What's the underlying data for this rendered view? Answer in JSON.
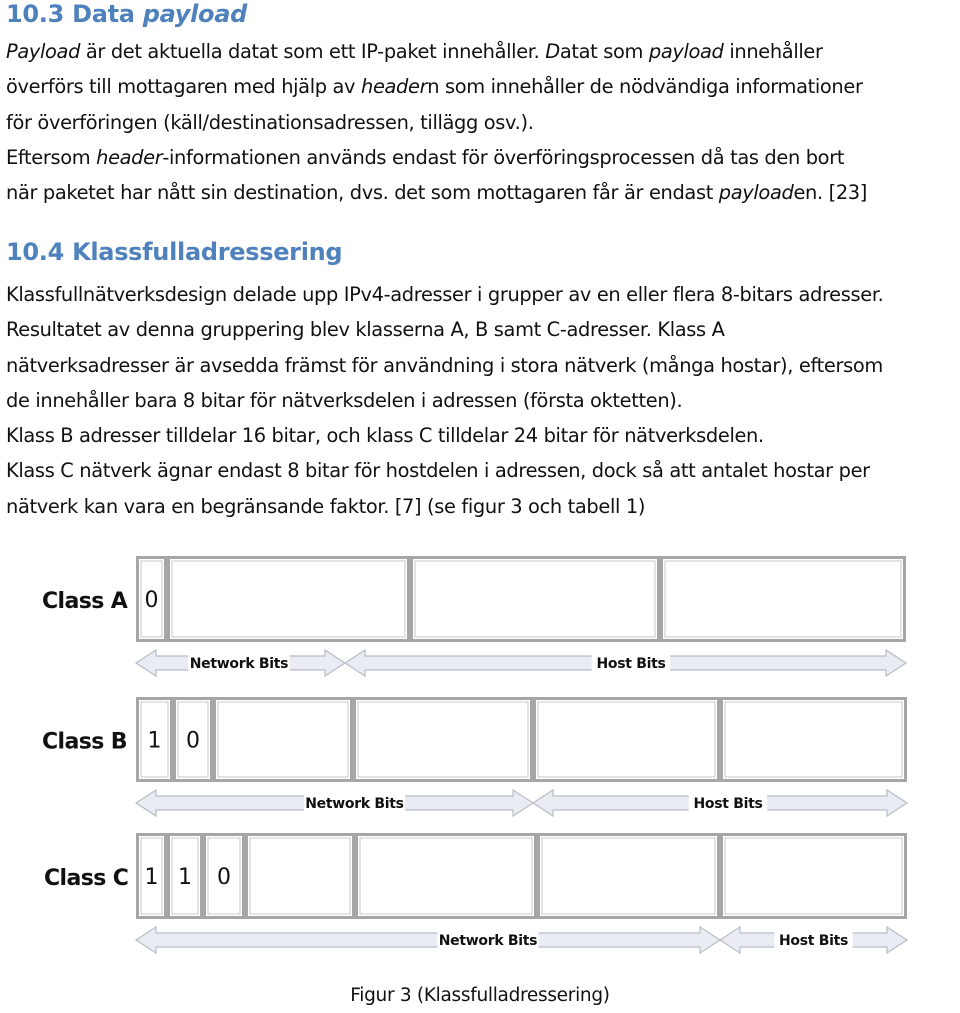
{
  "section_10_3": {
    "number": "10.3",
    "title_plain": "Data",
    "title_italic": "payload",
    "lines": [
      [
        {
          "t": "Payload",
          "i": true
        },
        {
          "t": " är det aktuella datat som ett IP-paket innehåller. "
        },
        {
          "t": "D",
          "i": true
        },
        {
          "t": "atat som "
        },
        {
          "t": "payload",
          "i": true
        },
        {
          "t": " innehåller"
        }
      ],
      [
        {
          "t": "överförs till mottagaren med hjälp av "
        },
        {
          "t": "header",
          "i": true
        },
        {
          "t": "n som innehåller de nödvändiga informationer"
        }
      ],
      [
        {
          "t": "för överföringen (käll/destinationsadressen, tillägg osv.)."
        }
      ],
      [
        {
          "t": "Eftersom "
        },
        {
          "t": "header",
          "i": true
        },
        {
          "t": "-informationen används endast för överföringsprocessen då tas den bort"
        }
      ],
      [
        {
          "t": "när paketet har nått sin destination, dvs. det som mottagaren får är endast "
        },
        {
          "t": "payload",
          "i": true
        },
        {
          "t": "en. [23]"
        }
      ]
    ]
  },
  "section_10_4": {
    "title": "10.4 Klassfulladressering",
    "lines": [
      [
        {
          "t": "Klassfullnätverksdesign delade upp IPv4-adresser i grupper av en eller flera 8-bitars adresser."
        }
      ],
      [
        {
          "t": "Resultatet av denna gruppering blev klasserna A, B samt C-adresser. Klass A"
        }
      ],
      [
        {
          "t": "nätverksadresser är avsedda främst för användning i stora nätverk (många hostar), eftersom"
        }
      ],
      [
        {
          "t": "de innehåller bara 8 bitar för nätverksdelen i adressen (första oktetten)."
        }
      ],
      [
        {
          "t": "Klass B adresser tilldelar 16 bitar, och klass C tilldelar 24 bitar för nätverksdelen."
        }
      ],
      [
        {
          "t": "Klass C nätverk ägnar endast 8 bitar för hostdelen i adressen, dock så att antalet hostar per"
        }
      ],
      [
        {
          "t": "nätverk kan vara en begränsande faktor. [7] (se figur 3 och tabell 1)"
        }
      ]
    ]
  },
  "figure": {
    "colors": {
      "box_border": "#a6a6a6",
      "box_fill": "#ffffff",
      "arrow_fill": "#e9edf3",
      "arrow_border": "#b8bcc4",
      "text": "#111111"
    },
    "network_label": "Network Bits",
    "host_label": "Host Bits",
    "classes": [
      {
        "label": "Class A",
        "leading_bits": [
          "0"
        ],
        "network_octets": 1,
        "host_octets": 3
      },
      {
        "label": "Class B",
        "leading_bits": [
          "1",
          "0"
        ],
        "network_octets": 2,
        "host_octets": 2
      },
      {
        "label": "Class C",
        "leading_bits": [
          "1",
          "1",
          "0"
        ],
        "network_octets": 3,
        "host_octets": 1
      }
    ],
    "caption": "Figur 3 (Klassfulladressering)"
  }
}
